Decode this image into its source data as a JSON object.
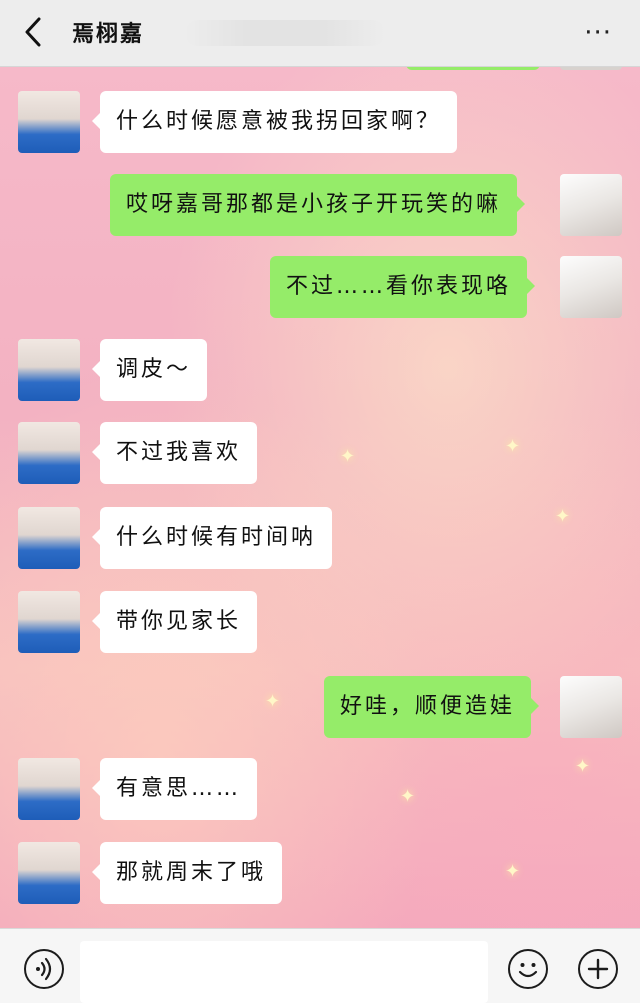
{
  "header": {
    "contact_name": "焉栩嘉",
    "more_label": "···"
  },
  "messages": [
    {
      "side": "in",
      "text": "什么时候愿意被我拐回家啊？"
    },
    {
      "side": "out",
      "text": "哎呀嘉哥那都是小孩子开玩笑的嘛"
    },
    {
      "side": "out",
      "text": "不过……看你表现咯"
    },
    {
      "side": "in",
      "text": "调皮～"
    },
    {
      "side": "in",
      "text": "不过我喜欢"
    },
    {
      "side": "in",
      "text": "什么时候有时间呐"
    },
    {
      "side": "in",
      "text": "带你见家长"
    },
    {
      "side": "out",
      "text": "好哇，顺便造娃"
    },
    {
      "side": "in",
      "text": "有意思……"
    },
    {
      "side": "in",
      "text": "那就周末了哦"
    }
  ],
  "icons": {
    "back": "chevron-left-icon",
    "more": "ellipsis-icon",
    "voice": "voice-icon",
    "emoji": "emoji-icon",
    "plus": "plus-icon"
  },
  "colors": {
    "outgoing_bubble": "#95ec69",
    "incoming_bubble": "#ffffff",
    "header_bg": "#ededed"
  }
}
